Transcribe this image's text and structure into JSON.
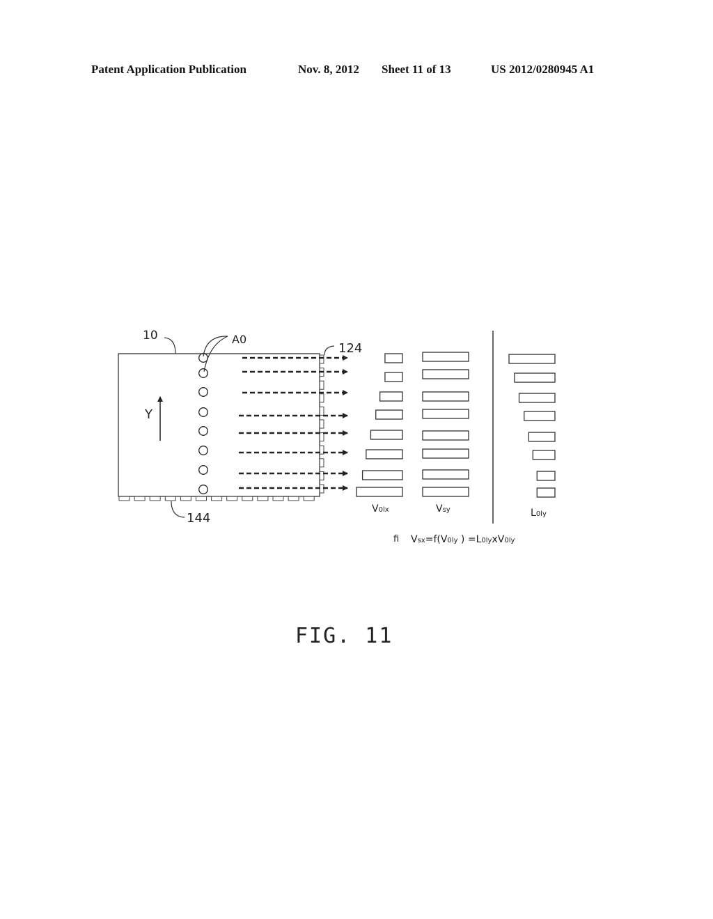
{
  "header": {
    "publication": "Patent Application Publication",
    "date": "Nov. 8, 2012",
    "sheet": "Sheet 11 of 13",
    "number": "US 2012/0280945 A1"
  },
  "figure": {
    "caption": "FIG. 11",
    "labels": {
      "panel": "10",
      "points": "A0",
      "right_sensors": "124",
      "bottom_sensors": "144",
      "axis": "Y"
    },
    "point_count": 8,
    "arrow_count": 8,
    "columns": [
      {
        "id": "v0lx",
        "label_main": "V",
        "label_sub": "0lx",
        "relative_lengths": [
          0.38,
          0.38,
          0.49,
          0.58,
          0.69,
          0.79,
          0.87,
          1.0
        ]
      },
      {
        "id": "vsy",
        "label_main": "V",
        "label_sub": "sy",
        "relative_lengths": [
          1.0,
          1.0,
          1.0,
          1.0,
          1.0,
          1.0,
          1.0,
          1.0
        ]
      },
      {
        "id": "l0ly",
        "label_main": "L",
        "label_sub": "0ly",
        "relative_lengths": [
          1.0,
          0.88,
          0.78,
          0.67,
          0.57,
          0.48,
          0.39,
          0.39
        ]
      }
    ],
    "formula": {
      "prefix": "fi",
      "text_parts": [
        "V",
        "sx",
        "=f(",
        "V",
        "0ly",
        " ) =",
        "L",
        "0ly",
        "x",
        "V",
        "0ly"
      ]
    }
  }
}
